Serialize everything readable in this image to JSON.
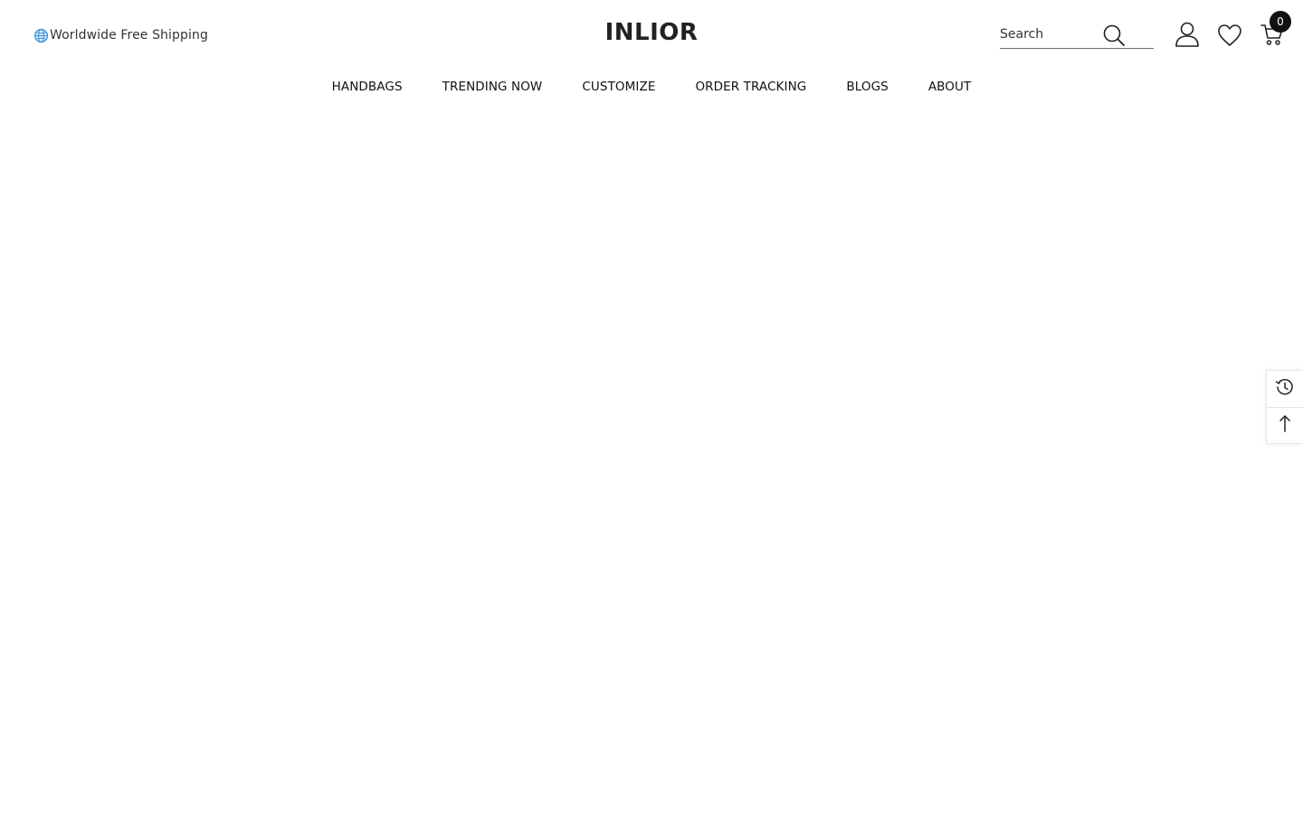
{
  "header": {
    "shipping_text": "Worldwide Free Shipping",
    "logo": "INLIOR",
    "search": {
      "placeholder": "Search"
    },
    "cart_count": "0"
  },
  "nav": {
    "items": [
      "HANDBAGS",
      "TRENDING NOW",
      "CUSTOMIZE",
      "ORDER TRACKING",
      "BLOGS",
      "ABOUT"
    ]
  },
  "icons": {
    "globe": "globe-icon",
    "search": "search-icon",
    "account": "user-icon",
    "wishlist": "heart-icon",
    "cart": "cart-icon",
    "recently_viewed": "history-icon",
    "back_to_top": "arrow-up-icon"
  },
  "colors": {
    "text": "#111111",
    "globe": "#3a8fd6",
    "badge": "#111111"
  }
}
